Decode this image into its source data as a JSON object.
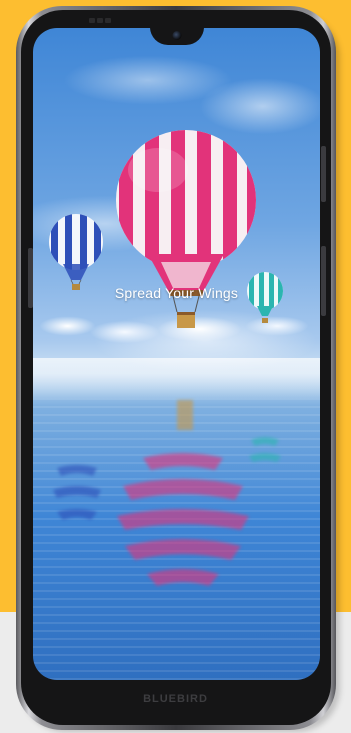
{
  "wallpaper": {
    "tagline": "Spread Your Wings"
  },
  "device": {
    "brand_label": "BLUEBIRD"
  },
  "colors": {
    "background": "#FDBE30",
    "bottom_band": "#ECECEC",
    "bezel": "#151516",
    "balloon_main_stripe": "#E2337A",
    "balloon_left_stripe": "#2E4FB8",
    "balloon_right_stripe": "#2BB5B0"
  },
  "icons": {
    "camera": "front-camera-icon",
    "speaker": "earpiece-speaker-icon"
  }
}
